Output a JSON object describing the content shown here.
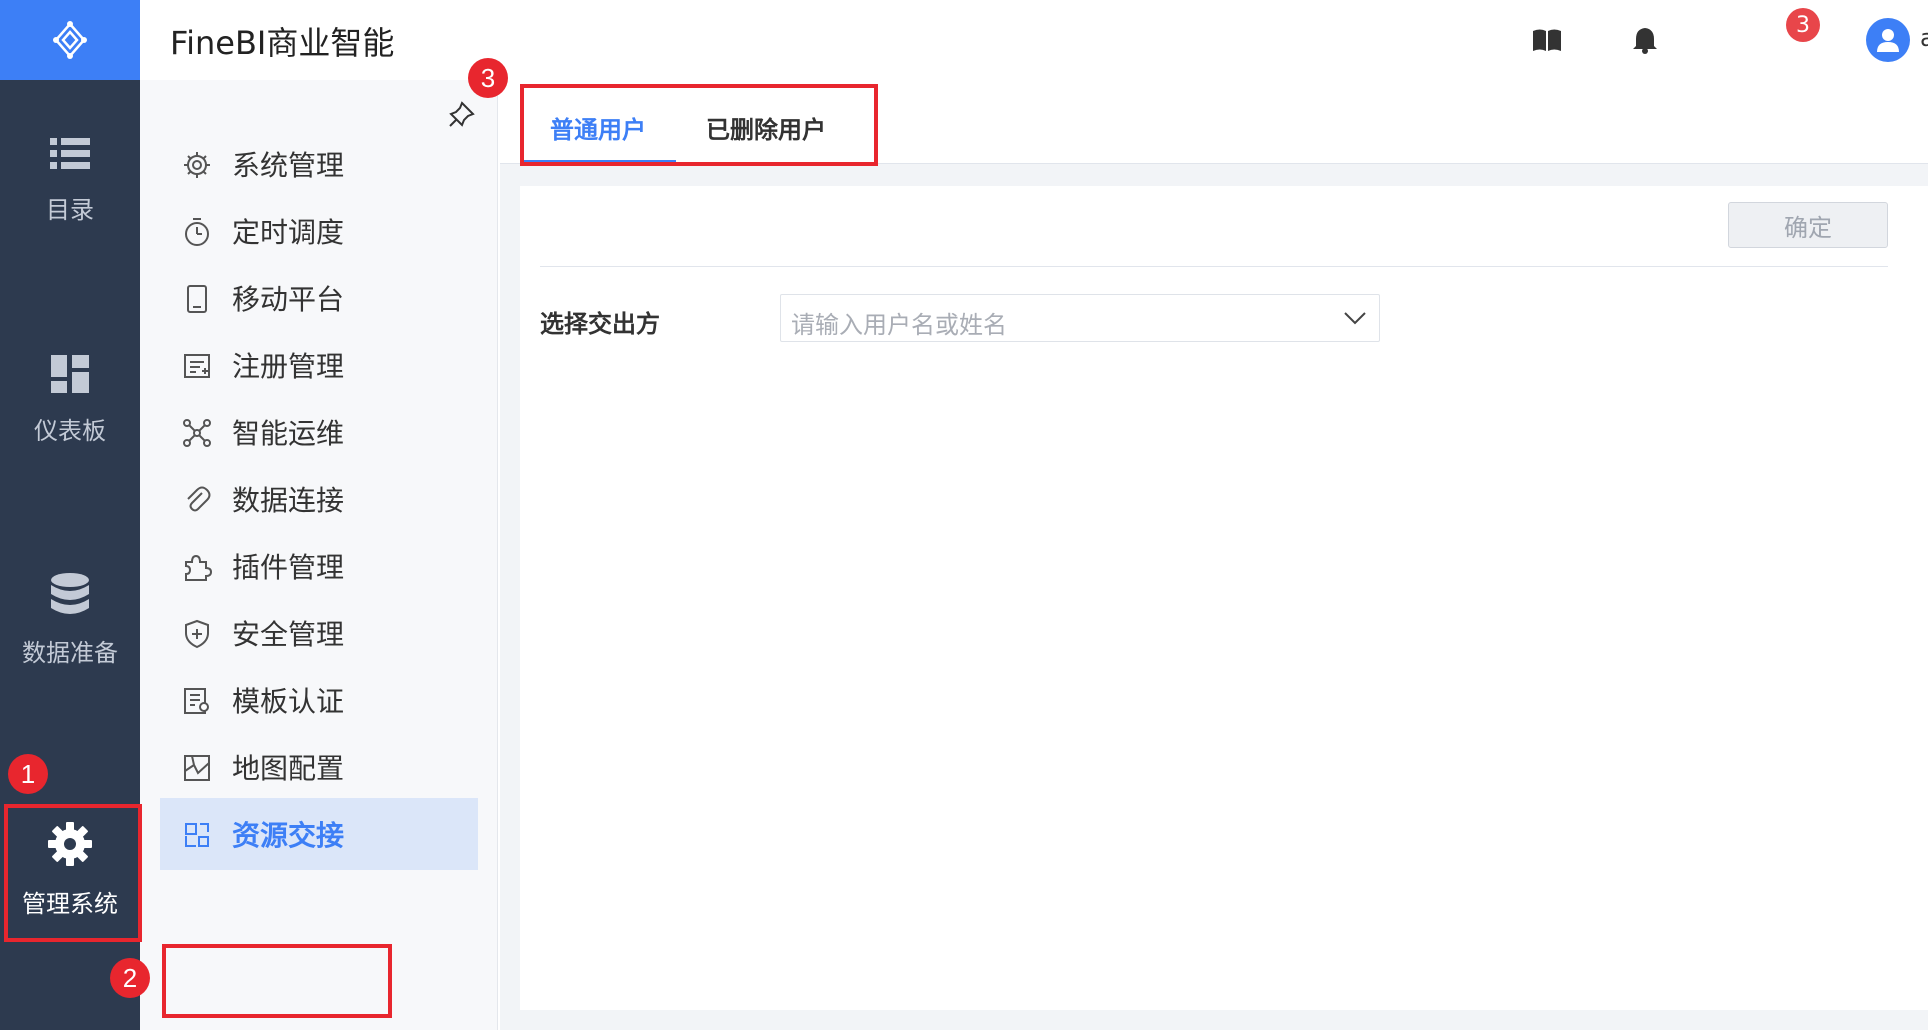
{
  "app": {
    "title": "FineBI商业智能"
  },
  "header": {
    "notification_count": "3",
    "user_name": "admin"
  },
  "rail": {
    "items": [
      {
        "label": "目录",
        "icon": "list-icon"
      },
      {
        "label": "仪表板",
        "icon": "dashboard-icon"
      },
      {
        "label": "数据准备",
        "icon": "database-icon"
      },
      {
        "label": "管理系统",
        "icon": "gear-icon",
        "active": true
      }
    ]
  },
  "submenu": {
    "items": [
      {
        "label": "系统管理",
        "icon": "settings-icon"
      },
      {
        "label": "定时调度",
        "icon": "timer-icon"
      },
      {
        "label": "移动平台",
        "icon": "mobile-icon"
      },
      {
        "label": "注册管理",
        "icon": "register-icon"
      },
      {
        "label": "智能运维",
        "icon": "network-icon"
      },
      {
        "label": "数据连接",
        "icon": "paperclip-icon"
      },
      {
        "label": "插件管理",
        "icon": "puzzle-icon"
      },
      {
        "label": "安全管理",
        "icon": "shield-icon"
      },
      {
        "label": "模板认证",
        "icon": "template-icon"
      },
      {
        "label": "地图配置",
        "icon": "map-icon"
      },
      {
        "label": "资源交接",
        "icon": "resource-icon",
        "active": true
      }
    ]
  },
  "tabs": [
    {
      "label": "普通用户",
      "active": true
    },
    {
      "label": "已删除用户",
      "active": false
    }
  ],
  "panel": {
    "confirm_label": "确定",
    "field_label": "选择交出方",
    "select_placeholder": "请输入用户名或姓名"
  },
  "annotations": [
    "1",
    "2",
    "3"
  ],
  "colors": {
    "accent": "#3d7ff6",
    "rail_bg": "#2d3a4f",
    "annotation": "#e8262e",
    "badge": "#e8464a"
  }
}
